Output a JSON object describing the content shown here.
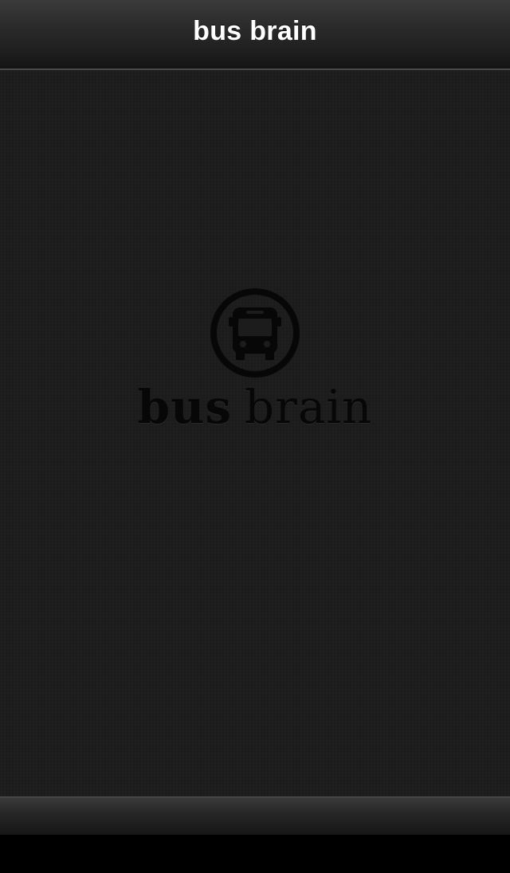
{
  "navbar": {
    "title": "bus brain"
  },
  "logo": {
    "icon": "bus-icon",
    "word_bold": "bus",
    "word_regular": "brain"
  },
  "colors": {
    "navbar_top": "#3a3a3a",
    "content_background": "#1c1c1c",
    "logo_color": "#070707",
    "title_color": "#ffffff"
  }
}
